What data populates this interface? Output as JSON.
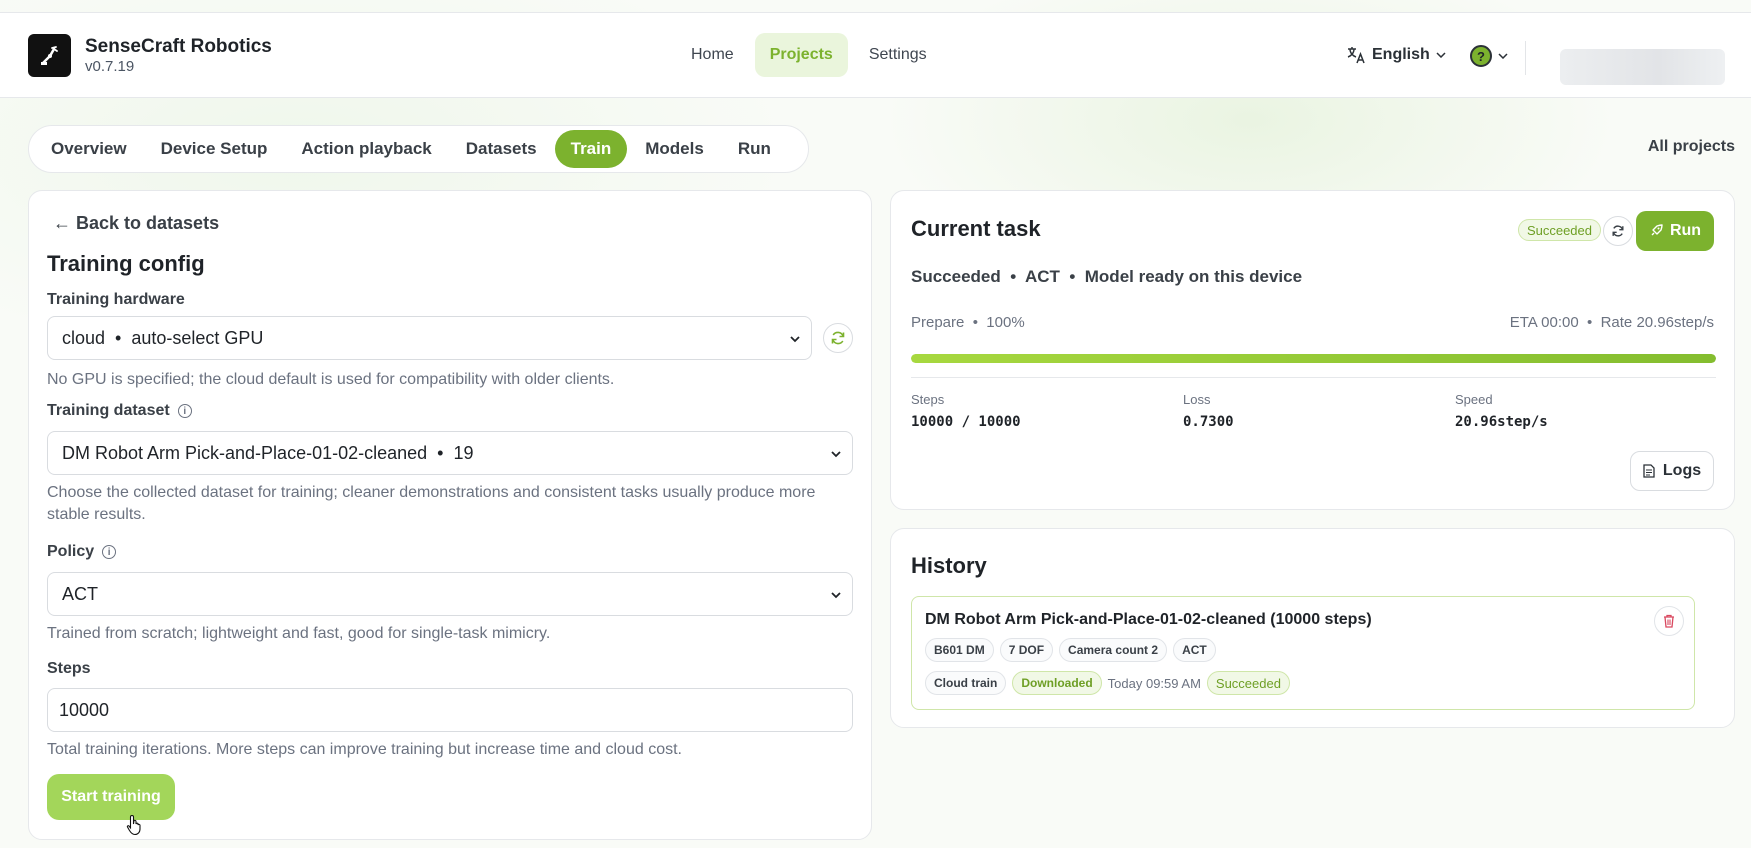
{
  "brand": {
    "name": "SenseCraft Robotics",
    "version": "v0.7.19"
  },
  "topnav": {
    "home": "Home",
    "projects": "Projects",
    "settings": "Settings"
  },
  "language": "English",
  "subnav": {
    "items": [
      "Overview",
      "Device Setup",
      "Action playback",
      "Datasets",
      "Train",
      "Models",
      "Run"
    ],
    "active": "Train",
    "all_projects": "All projects"
  },
  "config": {
    "back": "Back to datasets",
    "title": "Training config",
    "hardware": {
      "label": "Training hardware",
      "value": "cloud  •  auto-select GPU",
      "help": "No GPU is specified; the cloud default is used for compatibility with older clients."
    },
    "dataset": {
      "label": "Training dataset",
      "value": "DM Robot Arm Pick-and-Place-01-02-cleaned  •  19",
      "help": "Choose the collected dataset for training; cleaner demonstrations and consistent tasks usually produce more stable results."
    },
    "policy": {
      "label": "Policy",
      "value": "ACT",
      "help": "Trained from scratch; lightweight and fast, good for single-task mimicry."
    },
    "steps": {
      "label": "Steps",
      "value": "10000",
      "help": "Total training iterations. More steps can improve training but increase time and cloud cost."
    },
    "start_label": "Start training"
  },
  "task": {
    "title": "Current task",
    "badge": "Succeeded",
    "run_label": "Run",
    "status_line": "Succeeded  •  ACT  •  Model ready on this device",
    "prepare": "Prepare  •  100%",
    "eta_rate": "ETA 00:00  •  Rate 20.96step/s",
    "progress_fraction": 1.0,
    "stats": [
      {
        "label": "Steps",
        "value": "10000 / 10000"
      },
      {
        "label": "Loss",
        "value": "0.7300"
      },
      {
        "label": "Speed",
        "value": "20.96step/s"
      }
    ],
    "logs_label": "Logs"
  },
  "history": {
    "title": "History",
    "items": [
      {
        "title": "DM Robot Arm Pick-and-Place-01-02-cleaned (10000 steps)",
        "tags": [
          "B601 DM",
          "7 DOF",
          "Camera count 2",
          "ACT"
        ],
        "mode": "Cloud train",
        "download_state": "Downloaded",
        "time": "Today 09:59 AM",
        "status": "Succeeded"
      }
    ]
  },
  "colors": {
    "accent": "#7cb22e",
    "accent_light": "#a3d65a",
    "success_bg": "#f1f8e6"
  },
  "icons": {
    "logo": "robot-arm-logo",
    "language": "translate-icon",
    "help": "help-icon",
    "refresh": "refresh-icon",
    "rocket": "rocket-icon",
    "logs": "document-icon",
    "trash": "trash-icon"
  }
}
